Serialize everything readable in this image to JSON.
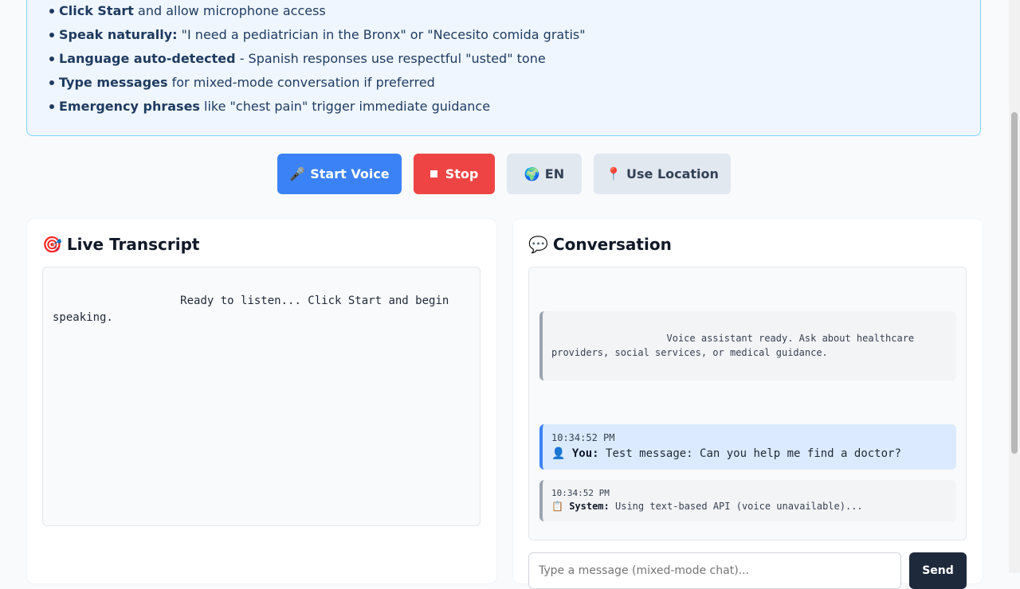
{
  "instructions": {
    "items": [
      {
        "bold": "Click Start",
        "rest": " and allow microphone access"
      },
      {
        "bold": "Speak naturally:",
        "rest": " \"I need a pediatrician in the Bronx\" or \"Necesito comida gratis\""
      },
      {
        "bold": "Language auto-detected",
        "rest": " - Spanish responses use respectful \"usted\" tone"
      },
      {
        "bold": "Type messages",
        "rest": " for mixed-mode conversation if preferred"
      },
      {
        "bold": "Emergency phrases",
        "rest": " like \"chest pain\" trigger immediate guidance"
      }
    ]
  },
  "controls": {
    "start": {
      "icon": "🎤",
      "label": "Start Voice"
    },
    "stop": {
      "label": "Stop"
    },
    "language": {
      "icon": "🌍",
      "label": "EN"
    },
    "location": {
      "icon": "📍",
      "label": "Use Location"
    }
  },
  "transcript": {
    "icon": "🎯",
    "title": "Live Transcript",
    "text": "                   Ready to listen... Click Start and begin speaking."
  },
  "conversation": {
    "icon": "💬",
    "title": "Conversation",
    "ready_message": "                    Voice assistant ready. Ask about healthcare providers, social services, or medical guidance.",
    "messages": [
      {
        "time": "10:34:52 PM",
        "icon": "👤",
        "speaker": "You:",
        "text": "Test message: Can you help me find a doctor?"
      },
      {
        "time": "10:34:52 PM",
        "icon": "📋",
        "speaker": "System:",
        "text": "Using text-based API (voice unavailable)..."
      }
    ],
    "input_placeholder": "Type a message (mixed-mode chat)...",
    "send_label": "Send"
  },
  "colors": {
    "primary": "#3b82f6",
    "danger": "#ef4444",
    "info_bg": "#eff6ff",
    "dark_button": "#1e293b"
  }
}
